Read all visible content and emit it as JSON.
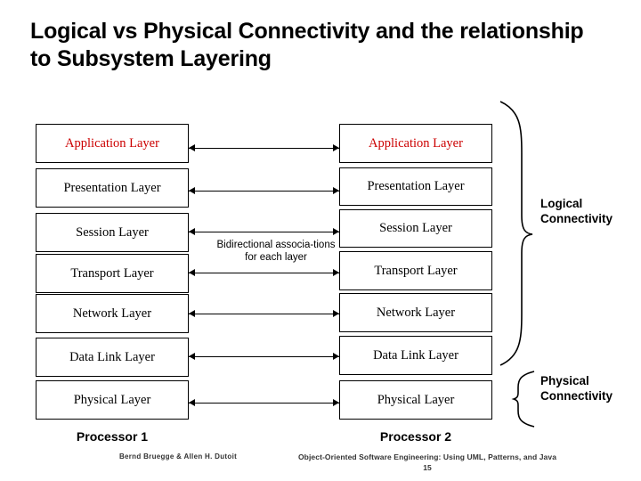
{
  "title": "Logical vs Physical Connectivity and the relationship to Subsystem Layering",
  "diagram": {
    "left_column": {
      "processor_label": "Processor 1",
      "layers": [
        "Application Layer",
        "Presentation Layer",
        "Session Layer",
        "Transport Layer",
        "Network Layer",
        "Data Link Layer",
        "Physical Layer"
      ]
    },
    "right_column": {
      "processor_label": "Processor 2",
      "layers": [
        "Application Layer",
        "Presentation Layer",
        "Session Layer",
        "Transport Layer",
        "Network Layer",
        "Data Link Layer",
        "Physical Layer"
      ]
    },
    "association_label": "Bidirectional associa-tions for each layer",
    "side_labels": {
      "logical": "Logical Connectivity",
      "physical": "Physical Connectivity"
    },
    "colors": {
      "application_layer_text": "#cc0000",
      "box_border": "#000000",
      "text": "#000000"
    }
  },
  "footer": {
    "left": "Bernd Bruegge & Allen H. Dutoit",
    "right": "Object-Oriented Software Engineering: Using UML, Patterns, and Java",
    "page": "15"
  }
}
